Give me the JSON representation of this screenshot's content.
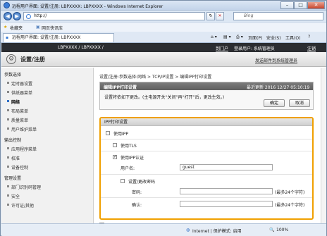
{
  "window": {
    "title": "远程用户界面: 设置/注册: LBPXXXX: LBPXXXX - Windows Internet Explorer"
  },
  "address": {
    "url": "http://",
    "search_placeholder": "Bing"
  },
  "favorites": {
    "label": "收藏夹",
    "item": "网页快讯库"
  },
  "tab": {
    "label": "远程用户界面: 设置/注册: LBPXXXX"
  },
  "toolbar": {
    "page": "页面(P)",
    "safety": "安全(S)",
    "tools": "工具(O)",
    "help": "?"
  },
  "header": {
    "device": "LBPXXXX / LBPXXXX /",
    "portal": "到门户",
    "login_user": "登录用户: 系统管理员",
    "logout": "注销",
    "page_title": "设置/注册",
    "mail_admin": "发送邮件到系统管理员"
  },
  "sidebar": {
    "groups": [
      {
        "label": "参数选择",
        "items": [
          "定时器设置",
          "供纸器菜单",
          "网络",
          "布局菜单",
          "质量菜单",
          "用户维护菜单"
        ]
      },
      {
        "label": "输出控制",
        "items": [
          "应用程序菜单",
          "校准",
          "设备控制"
        ]
      },
      {
        "label": "管理设置",
        "items": [
          "部门识别码管理",
          "安全",
          "许可证/其他"
        ]
      }
    ],
    "active": "网络"
  },
  "main": {
    "breadcrumb": "设置/注册:参数选择:网络 > TCP/IP设置 > 编辑IPP打印设置",
    "panel_title": "编辑IPP打印设置",
    "last_updated": "最近更新 2016 12/27 05:10:19",
    "note": "设置将依如下更改。(主电源开关“关闭”再“打开”后，更改生效。)",
    "ok": "确定",
    "cancel": "取消"
  },
  "ipp": {
    "section_title": "IPP打印设置",
    "use_ipp": "使用IPP",
    "use_tls": "使用TLS",
    "use_auth": "使用IPP认证",
    "username_label": "用户名:",
    "username_value": "guest",
    "set_password": "设置/更改密码",
    "password_label": "密码:",
    "password_hint": "(最多24个字符)",
    "confirm_label": "确认:",
    "confirm_hint": "(最多24个字符)"
  },
  "status": {
    "zone": "Internet | 保护模式: 启用",
    "zoom": "100%"
  }
}
